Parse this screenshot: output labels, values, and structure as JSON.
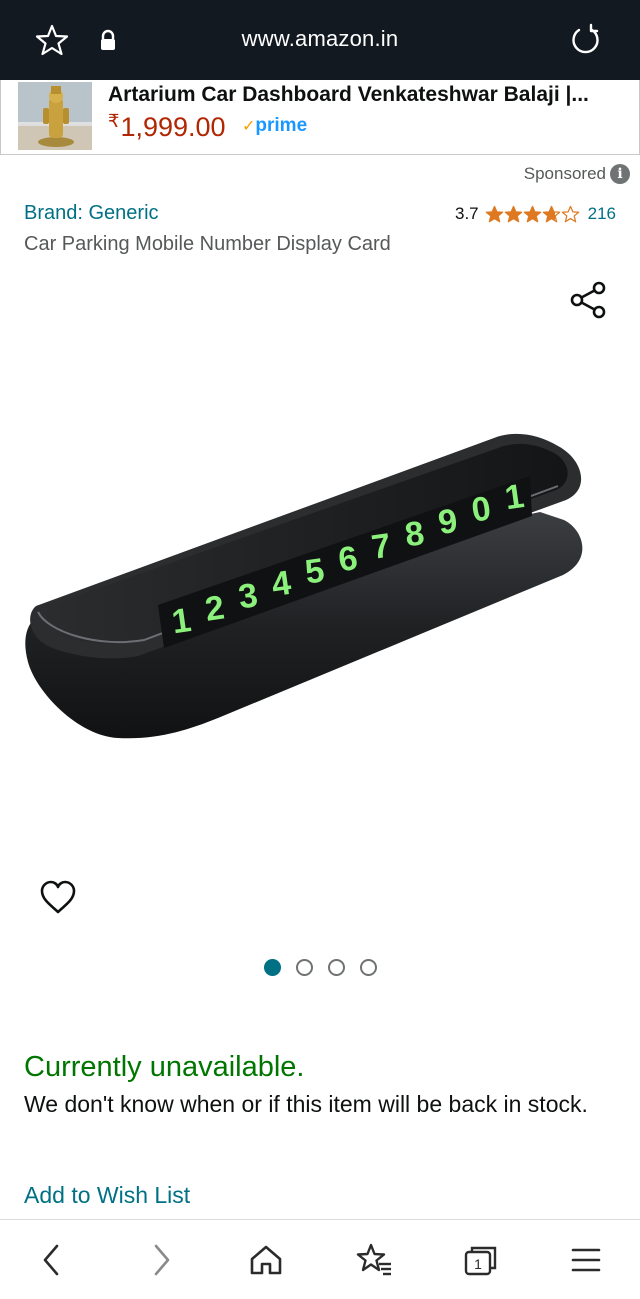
{
  "browser": {
    "url": "www.amazon.in",
    "icons": [
      "star-outline-icon",
      "lock-icon",
      "reload-icon"
    ]
  },
  "ad": {
    "title": "Artarium Car Dashboard Venkateshwar Balaji |...",
    "price_symbol": "₹",
    "price": "1,999.00",
    "prime_check": "✓",
    "prime": "prime"
  },
  "sponsored": {
    "label": "Sponsored",
    "info_glyph": "i"
  },
  "product": {
    "brand": "Brand: Generic",
    "title": "Car Parking Mobile Number Display Card",
    "rating": "3.7",
    "rating_value": 3.7,
    "rating_max": 5,
    "review_count": "216",
    "digits": [
      "1",
      "2",
      "3",
      "4",
      "5",
      "6",
      "7",
      "8",
      "9",
      "0",
      "1"
    ],
    "image_count": 4,
    "active_image": 0
  },
  "availability": {
    "status": "Currently unavailable.",
    "message": "We don't know when or if this item will be back in stock.",
    "wishlist": "Add to Wish List"
  },
  "bottom_nav": {
    "tab_count": "1",
    "icons": [
      "back-arrow-icon",
      "forward-arrow-icon",
      "home-icon",
      "bookmarks-icon",
      "tabs-icon",
      "menu-icon"
    ]
  },
  "colors": {
    "topbar": "#131921",
    "link": "#007185",
    "price": "#b12704",
    "available_status": "#007600",
    "star": "#de7921",
    "prime": "#1a98ff"
  }
}
